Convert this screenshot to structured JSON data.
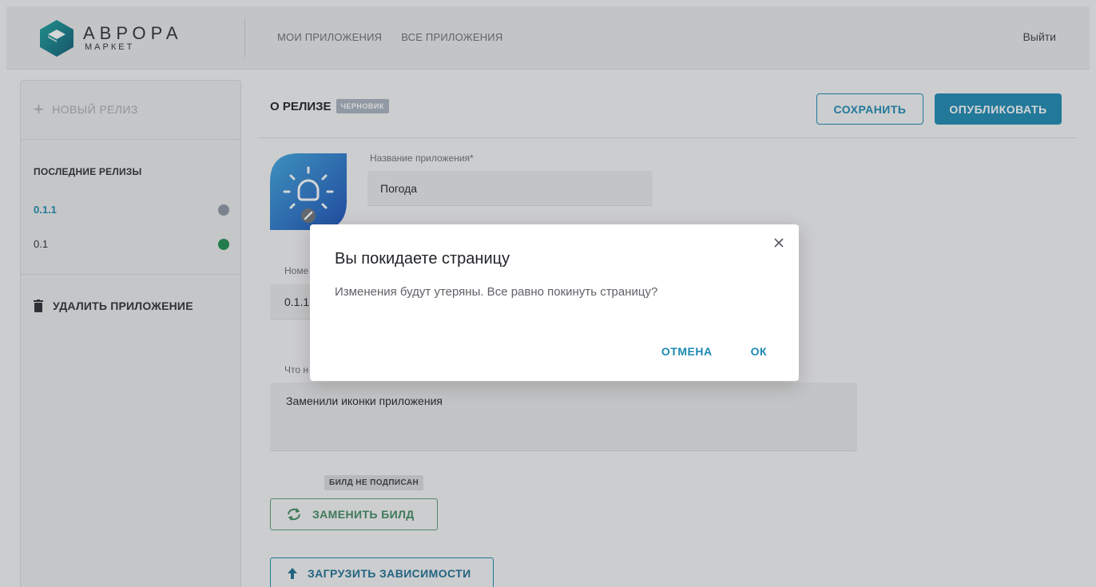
{
  "header": {
    "brand_name": "АВРОРА",
    "brand_sub": "МАРКЕТ",
    "nav": [
      "МОИ ПРИЛОЖЕНИЯ",
      "ВСЕ ПРИЛОЖЕНИЯ"
    ],
    "logout": "Выйти"
  },
  "sidebar": {
    "new_release": "НОВЫЙ РЕЛИЗ",
    "latest_title": "ПОСЛЕДНИЕ РЕЛИЗЫ",
    "releases": [
      {
        "version": "0.1.1",
        "status_color": "#8d97a4"
      },
      {
        "version": "0.1",
        "status_color": "#1d8e4f"
      }
    ],
    "delete_app": "УДАЛИТЬ ПРИЛОЖЕНИЕ"
  },
  "main": {
    "title": "О РЕЛИЗЕ",
    "badge": "ЧЕРНОВИК",
    "save_label": "СОХРАНИТЬ",
    "publish_label": "ОПУБЛИКОВАТЬ",
    "app_name_label": "Название приложения*",
    "app_name_value": "Погода",
    "version_label": "Номе",
    "version_value": "0.1.1",
    "whats_new_label": "Что н",
    "whats_new_value": "Заменили иконки приложения",
    "unsigned_badge": "БИЛД НЕ ПОДПИСАН",
    "replace_build": "ЗАМЕНИТЬ БИЛД",
    "upload_deps": "ЗАГРУЗИТЬ ЗАВИСИМОСТИ"
  },
  "dialog": {
    "title": "Вы покидаете страницу",
    "text": "Изменения будут утеряны. Все равно покинуть страницу?",
    "cancel": "ОТМЕНА",
    "ok": "ОК"
  },
  "colors": {
    "accent": "#1c8ab2",
    "green": "#3f8a5f"
  },
  "icons": [
    "logo-icon",
    "plus-icon",
    "trash-icon",
    "app-icon",
    "refresh-icon",
    "arrow-up-icon",
    "close-icon"
  ]
}
